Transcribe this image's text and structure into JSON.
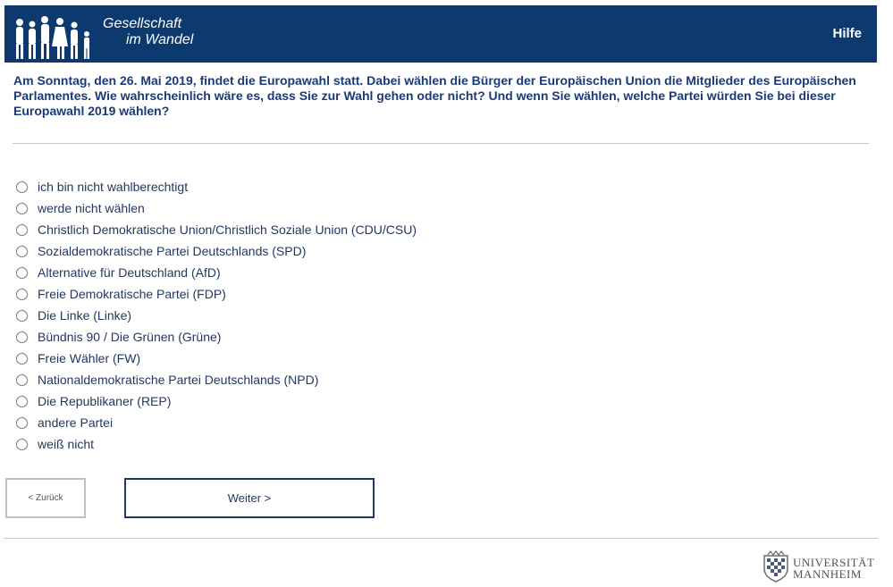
{
  "header": {
    "logo_line1": "Gesellschaft",
    "logo_line2": "im Wandel",
    "help_label": "Hilfe",
    "background_color": "#0c3a6e"
  },
  "question": {
    "text": "Am Sonntag, den 26. Mai 2019, findet die Europawahl statt. Dabei wählen die Bürger der Europäischen Union die Mitglieder des Europäischen Parlamentes. Wie wahrscheinlich wäre es, dass Sie zur Wahl gehen oder nicht? Und wenn Sie wählen, welche Partei würden Sie bei dieser Europawahl 2019 wählen?"
  },
  "options": [
    {
      "label": "ich bin nicht wahlberechtigt"
    },
    {
      "label": "werde nicht wählen"
    },
    {
      "label": "Christlich Demokratische Union/Christlich Soziale Union (CDU/CSU)"
    },
    {
      "label": "Sozialdemokratische Partei Deutschlands (SPD)"
    },
    {
      "label": "Alternative für Deutschland (AfD)"
    },
    {
      "label": "Freie Demokratische Partei (FDP)"
    },
    {
      "label": "Die Linke (Linke)"
    },
    {
      "label": "Bündnis 90 / Die Grünen (Grüne)"
    },
    {
      "label": "Freie Wähler (FW)"
    },
    {
      "label": "Nationaldemokratische Partei Deutschlands (NPD)"
    },
    {
      "label": "Die Republikaner (REP)"
    },
    {
      "label": "andere Partei"
    },
    {
      "label": "weiß nicht"
    }
  ],
  "nav": {
    "back_label": "< Zurück",
    "next_label": "Weiter >"
  },
  "footer": {
    "university_line1": "UNIVERSITÄT",
    "university_line2": "MANNHEIM",
    "logo_icon": "university-crest-icon"
  },
  "colors": {
    "accent": "#1f3864",
    "header": "#0c3a6e"
  }
}
